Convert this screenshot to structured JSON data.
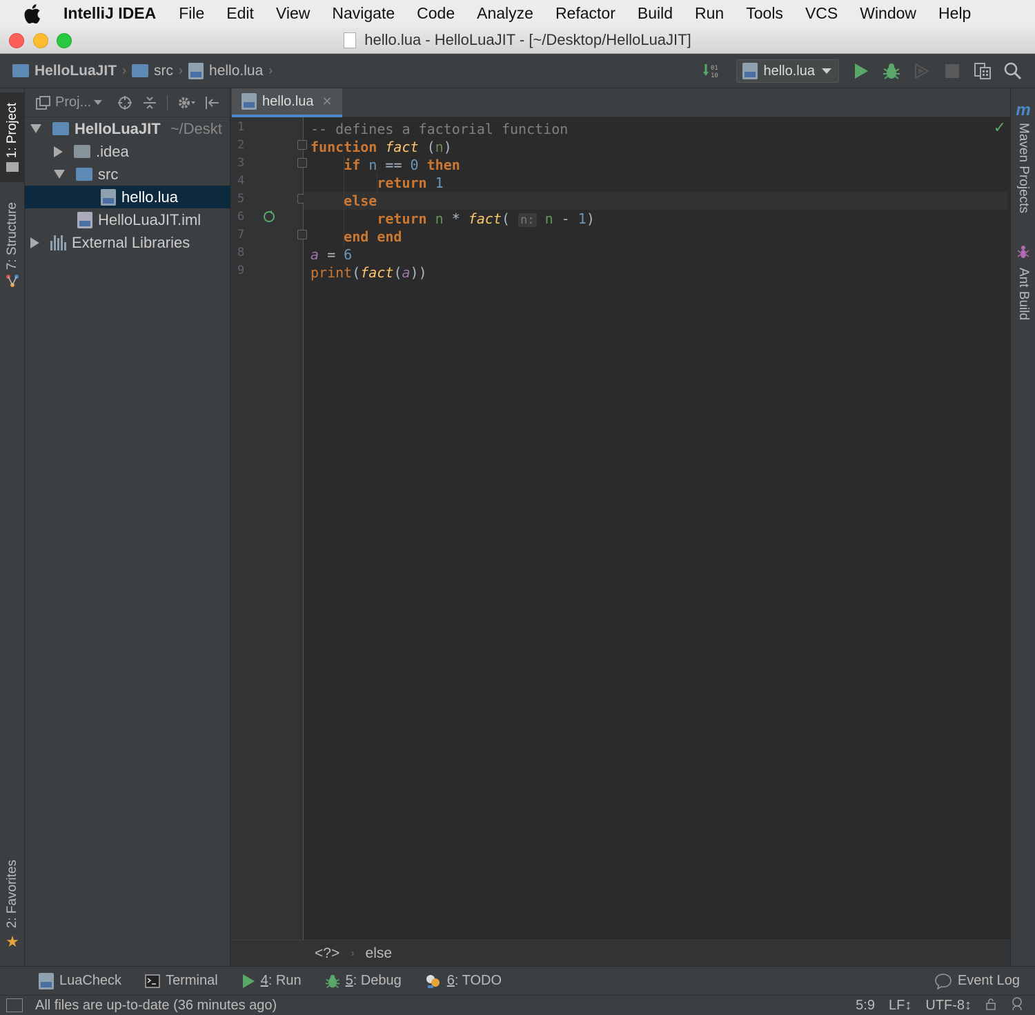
{
  "menubar": {
    "app_name": "IntelliJ IDEA",
    "items": [
      "File",
      "Edit",
      "View",
      "Navigate",
      "Code",
      "Analyze",
      "Refactor",
      "Build",
      "Run",
      "Tools",
      "VCS",
      "Window",
      "Help"
    ]
  },
  "window": {
    "title": "hello.lua - HelloLuaJIT - [~/Desktop/HelloLuaJIT]"
  },
  "navbar": {
    "breadcrumbs": [
      "HelloLuaJIT",
      "src",
      "hello.lua"
    ],
    "run_config": "hello.lua"
  },
  "left_strip": {
    "tabs": [
      "1: Project",
      "7: Structure",
      "2: Favorites"
    ]
  },
  "right_strip": {
    "tabs": [
      "Maven Projects",
      "Ant Build"
    ]
  },
  "project_panel": {
    "view_selector": "Proj...",
    "tree": [
      {
        "label": "HelloLuaJIT",
        "suffix": "~/Deskt"
      },
      {
        "label": ".idea"
      },
      {
        "label": "src"
      },
      {
        "label": "hello.lua"
      },
      {
        "label": "HelloLuaJIT.iml"
      },
      {
        "label": "External Libraries"
      }
    ]
  },
  "editor": {
    "tab_label": "hello.lua",
    "line_numbers": [
      "1",
      "2",
      "3",
      "4",
      "5",
      "6",
      "7",
      "8",
      "9"
    ],
    "code": {
      "l1": "-- defines a factorial function",
      "l2_kw": "function",
      "l2_name": "fact",
      "l2_open": " (",
      "l2_param": "n",
      "l2_close": ")",
      "l3_if": "if",
      "l3_n": "n",
      "l3_op": " == ",
      "l3_zero": "0",
      "l3_then": "then",
      "l4_return": "return",
      "l4_one": "1",
      "l5_else": "else",
      "l6_return": "return",
      "l6_n": "n",
      "l6_op": " * ",
      "l6_fact": "fact",
      "l6_paren": "( ",
      "l6_hint": "n:",
      "l6_n2": "n",
      "l6_minus": " - ",
      "l6_one": "1",
      "l6_close": ")",
      "l7_end1": "end",
      "l7_end2": "end",
      "l8_a": "a",
      "l8_eq": " = ",
      "l8_six": "6",
      "l9_print": "print",
      "l9_open": "(",
      "l9_fact": "fact",
      "l9_open2": "(",
      "l9_a": "a",
      "l9_close": "))"
    },
    "breadcrumbs": [
      "<?>",
      "else"
    ]
  },
  "bottom_tools": {
    "luacheck": "LuaCheck",
    "terminal": "Terminal",
    "run_num": "4",
    "run_label": ": Run",
    "debug_num": "5",
    "debug_label": ": Debug",
    "todo_num": "6",
    "todo_label": ": TODO",
    "event_log": "Event Log"
  },
  "status_bar": {
    "message": "All files are up-to-date (36 minutes ago)",
    "position": "5:9",
    "line_sep": "LF↕",
    "encoding": "UTF-8↕"
  }
}
